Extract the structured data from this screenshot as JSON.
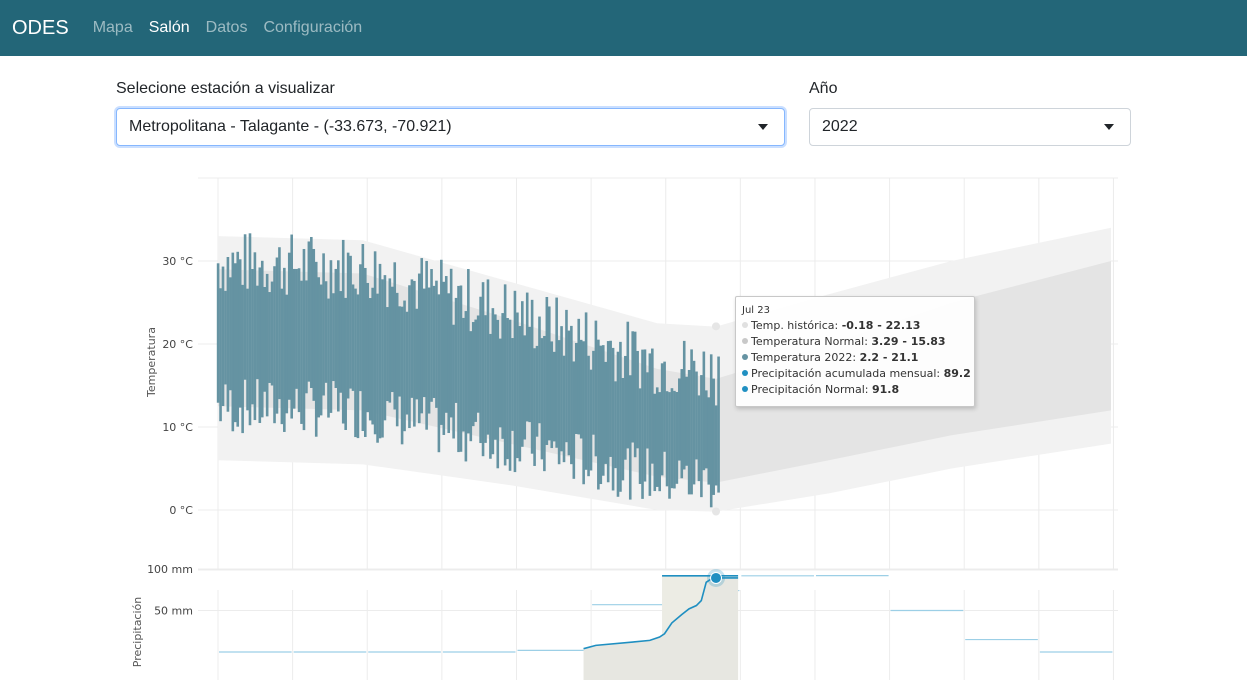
{
  "navbar": {
    "brand": "ODES",
    "links": [
      {
        "label": "Mapa",
        "active": false
      },
      {
        "label": "Salón",
        "active": true
      },
      {
        "label": "Datos",
        "active": false
      },
      {
        "label": "Configuración",
        "active": false
      }
    ]
  },
  "filters": {
    "station_label": "Selecione estación a visualizar",
    "station_value": "Metropolitana - Talagante - (-33.673, -70.921)",
    "year_label": "Año",
    "year_value": "2022"
  },
  "colors": {
    "navbar": "#236678",
    "temp_series": "#6593a2",
    "precip_series": "#1f8fc1",
    "band_hist": "#f2f2f2",
    "band_normal": "#e4e4e4"
  },
  "tooltip": {
    "date": "Jul 23",
    "rows": [
      {
        "label": "Temp. histórica: ",
        "value": "-0.18 - 22.13",
        "color": "#e0e0e0"
      },
      {
        "label": "Temperatura Normal: ",
        "value": "3.29 - 15.83",
        "color": "#c8c8c8"
      },
      {
        "label": "Temperatura 2022: ",
        "value": "2.2 - 21.1",
        "color": "#6593a2"
      },
      {
        "label": "Precipitación acumulada mensual: ",
        "value": "89.2",
        "color": "#1f8fc1"
      },
      {
        "label": "Precipitación Normal: ",
        "value": "91.8",
        "color": "#1f8fc1"
      }
    ]
  },
  "chart_data": [
    {
      "type": "area",
      "ylabel": "Temperatura",
      "y_ticks": [
        "30 °C",
        "20 °C",
        "10 °C",
        "0 °C"
      ],
      "y_tick_values": [
        30,
        20,
        10,
        0
      ],
      "ylim": [
        -3,
        34
      ],
      "x_range_days": [
        1,
        365
      ],
      "series": [
        {
          "name": "Temp. histórica",
          "day": [
            1,
            60,
            120,
            180,
            204,
            250,
            300,
            365
          ],
          "low": [
            6,
            5.5,
            3,
            0,
            -0.2,
            2,
            5,
            8
          ],
          "high": [
            33,
            32.5,
            27.5,
            22.5,
            22.1,
            26,
            30,
            34
          ]
        },
        {
          "name": "Temperatura Normal",
          "day": [
            1,
            60,
            120,
            180,
            204,
            250,
            300,
            365
          ],
          "low": [
            12.5,
            12,
            8,
            4,
            3.3,
            6,
            9,
            12
          ],
          "high": [
            29,
            28.5,
            23,
            17,
            15.8,
            20,
            25,
            30
          ]
        },
        {
          "name": "Temperatura 2022",
          "day_range": [
            1,
            205
          ]
        }
      ]
    },
    {
      "type": "line",
      "ylabel": "Precipitación",
      "y_ticks": [
        "100 mm",
        "50 mm"
      ],
      "y_tick_values": [
        100,
        50
      ],
      "series": [
        {
          "name": "Precipitación Normal",
          "month_values": [
            0,
            0,
            0,
            0,
            2,
            57,
            74,
            91.8,
            92,
            50,
            15,
            0
          ]
        },
        {
          "name": "Precipitación acumulada mensual",
          "day": [
            150,
            155,
            170,
            177,
            181,
            183,
            186,
            190,
            193,
            196,
            198,
            200,
            202,
            204,
            213
          ],
          "values": [
            4,
            8,
            12,
            14,
            18,
            22,
            35,
            45,
            52,
            56,
            62,
            84,
            88,
            89.2,
            89.2
          ]
        }
      ]
    }
  ]
}
